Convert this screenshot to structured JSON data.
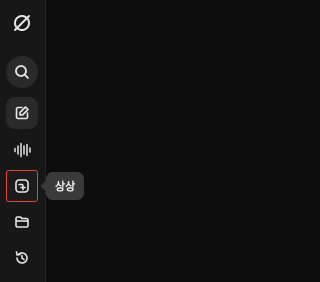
{
  "sidebar": {
    "items": [
      {
        "icon": "search-icon"
      },
      {
        "icon": "pencil-edit-icon"
      },
      {
        "icon": "audio-waveform-icon"
      },
      {
        "icon": "image-generate-icon"
      },
      {
        "icon": "folder-icon"
      },
      {
        "icon": "history-icon"
      }
    ]
  },
  "tooltip": {
    "label": "상상"
  },
  "colors": {
    "sidebar_bg": "#171717",
    "main_bg": "#0d0d0d",
    "icon": "#e6e6e6",
    "highlight_border": "#e0463a",
    "tooltip_bg": "#3a3a3a"
  }
}
